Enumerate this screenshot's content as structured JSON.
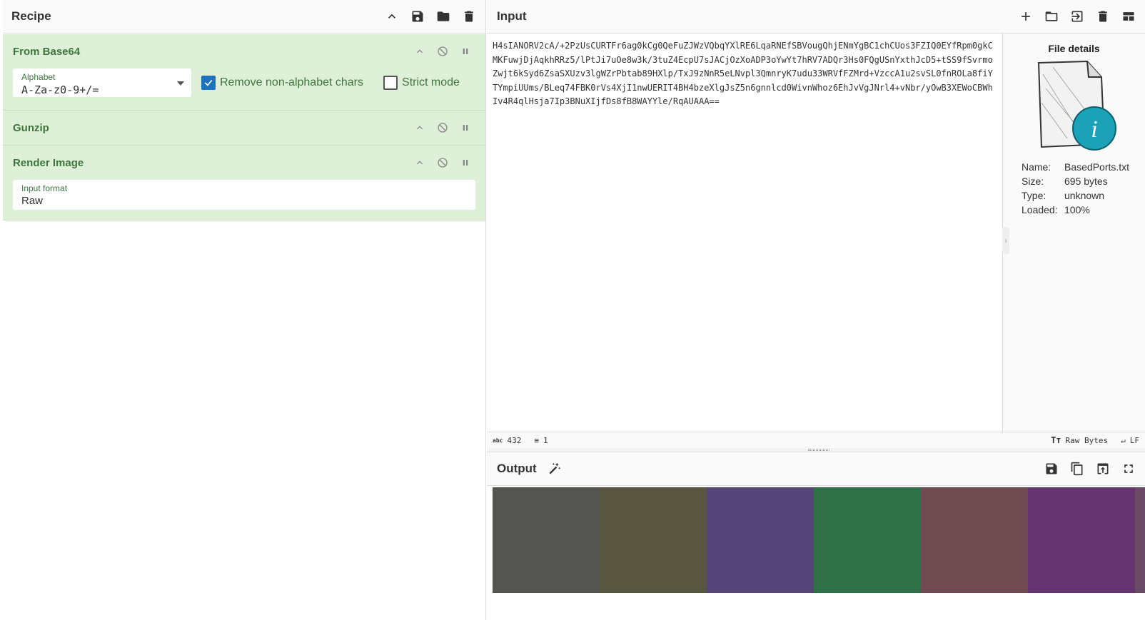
{
  "recipe": {
    "title": "Recipe",
    "operations": {
      "from_base64": {
        "title": "From Base64",
        "alphabet_label": "Alphabet",
        "alphabet_value": "A-Za-z0-9+/=",
        "remove_non_alpha_label": "Remove non-alphabet chars",
        "remove_non_alpha_checked": true,
        "strict_mode_label": "Strict mode",
        "strict_mode_checked": false
      },
      "gunzip": {
        "title": "Gunzip"
      },
      "render_image": {
        "title": "Render Image",
        "input_format_label": "Input format",
        "input_format_value": "Raw"
      }
    }
  },
  "input": {
    "title": "Input",
    "text": "H4sIANORV2cA/+2PzUsCURTFr6ag0kCg0QeFuZJWzVQbqYXlRE6LqaRNEfSBVougQhjENmYgBC1chCUos3FZIQ0EYfRpm0gkCMKFuwjDjAqkhRRz5/lPtJi7uOe8w3k/3tuZ4EcpU7sJACjOzXoADP3oYwYt7hRV7ADQr3Hs0FQgUSnYxthJcD5+tSS9fSvrmoZwjt6kSyd6ZsaSXUzv3lgWZrPbtab89HXlp/TxJ9zNnR5eLNvpl3QmnryK7udu33WRVfFZMrd+VzccA1u2svSL0fnROLa8fiYTYmpiUUms/BLeq74FBK0rVs4XjI1nwUERIT4BH4bzeXlgJsZ5n6gnnlcd0WivnWhoz6EhJvVgJNrl4+vNbr/yOwB3XEWoCBWhIv4R4qlHsja7Ip3BNuXIjfDs8fB8WAYYle/RqAUAAA==",
    "status": {
      "length": "432",
      "lines": "1",
      "encoding": "Raw Bytes",
      "eol": "LF"
    },
    "file_details": {
      "title": "File details",
      "name_key": "Name:",
      "name_value": "BasedPorts.txt",
      "size_key": "Size:",
      "size_value": "695 bytes",
      "type_key": "Type:",
      "type_value": "unknown",
      "loaded_key": "Loaded:",
      "loaded_value": "100%"
    }
  },
  "output": {
    "title": "Output",
    "swatches": [
      "#545551",
      "#585640",
      "#544477",
      "#2f7046",
      "#704a51",
      "#643470",
      "#6a4a66"
    ]
  }
}
